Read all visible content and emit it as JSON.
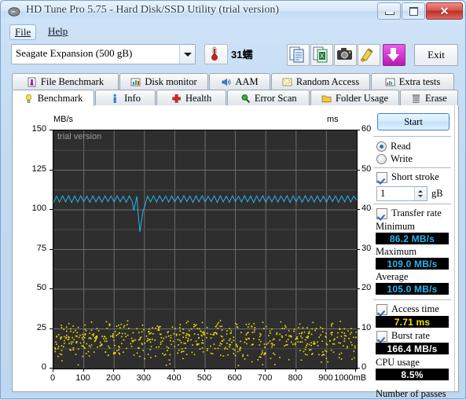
{
  "window": {
    "title": "HD Tune Pro 5.75 - Hard Disk/SSD Utility (trial version)",
    "icon": "hdtune-logo-icon",
    "controls": {
      "minimize": "minimize-icon",
      "maximize": "maximize-icon",
      "close": "close-icon"
    }
  },
  "menubar": {
    "items": [
      {
        "label": "File"
      },
      {
        "label": "Help"
      }
    ]
  },
  "toolbar": {
    "drive_select": {
      "value": "Seagate Expansion (500 gB)",
      "options": [
        "Seagate Expansion (500 gB)"
      ]
    },
    "temperature": {
      "icon": "thermometer-icon",
      "value": "31蠕"
    },
    "buttons": [
      {
        "name": "copy-to-clipboard-button",
        "icon": "copy-icon"
      },
      {
        "name": "export-excel-button",
        "icon": "excel-export-icon"
      },
      {
        "name": "screenshot-button",
        "icon": "camera-icon"
      },
      {
        "name": "clean-button",
        "icon": "brush-icon"
      },
      {
        "name": "download-button",
        "icon": "down-arrow-icon"
      }
    ],
    "exit_label": "Exit"
  },
  "tabs": {
    "top_row": [
      {
        "label": "File Benchmark",
        "icon": "file-benchmark-icon",
        "selected": false
      },
      {
        "label": "Disk monitor",
        "icon": "disk-monitor-icon",
        "selected": false
      },
      {
        "label": "AAM",
        "icon": "speaker-icon",
        "selected": false
      },
      {
        "label": "Random Access",
        "icon": "random-access-icon",
        "selected": false
      },
      {
        "label": "Extra tests",
        "icon": "extra-tests-icon",
        "selected": false
      }
    ],
    "bottom_row": [
      {
        "label": "Benchmark",
        "icon": "bulb-icon",
        "selected": true
      },
      {
        "label": "Info",
        "icon": "info-icon",
        "selected": false
      },
      {
        "label": "Health",
        "icon": "health-cross-icon",
        "selected": false
      },
      {
        "label": "Error Scan",
        "icon": "magnifier-icon",
        "selected": false
      },
      {
        "label": "Folder Usage",
        "icon": "folder-icon",
        "selected": false
      },
      {
        "label": "Erase",
        "icon": "trash-icon",
        "selected": false
      }
    ]
  },
  "controls": {
    "start_label": "Start",
    "mode": {
      "read_label": "Read",
      "write_label": "Write",
      "selected": "Read"
    },
    "short_stroke": {
      "label": "Short stroke",
      "checked": true,
      "value": "1",
      "unit": "gB"
    },
    "transfer_rate": {
      "label": "Transfer rate",
      "checked": true
    },
    "minimum": {
      "label": "Minimum",
      "value": "86.2 MB/s"
    },
    "maximum": {
      "label": "Maximum",
      "value": "109.0 MB/s"
    },
    "average": {
      "label": "Average",
      "value": "105.0 MB/s"
    },
    "access_time": {
      "label": "Access time",
      "checked": true,
      "value": "7.71 ms"
    },
    "burst_rate": {
      "label": "Burst rate",
      "checked": true,
      "value": "166.4 MB/s"
    },
    "cpu_usage": {
      "label": "CPU usage",
      "value": "8.5%"
    },
    "passes_label": "Number of passes"
  },
  "chart_data": {
    "type": "line",
    "title": "",
    "watermark": "trial version",
    "xlabel": "",
    "ylabel": "MB/s",
    "y2label": "ms",
    "xlim": [
      0,
      1000
    ],
    "ylim": [
      0,
      150
    ],
    "y2lim": [
      0,
      60
    ],
    "x_ticks": [
      "0",
      "100",
      "200",
      "300",
      "400",
      "500",
      "600",
      "700",
      "800",
      "900",
      "1000mB"
    ],
    "x_tick_values": [
      0,
      100,
      200,
      300,
      400,
      500,
      600,
      700,
      800,
      900,
      1000
    ],
    "y_ticks": [
      "0",
      "25",
      "50",
      "75",
      "100",
      "125",
      "150"
    ],
    "y_tick_values": [
      0,
      25,
      50,
      75,
      100,
      125,
      150
    ],
    "y2_ticks": [
      "0",
      "10",
      "20",
      "30",
      "40",
      "50",
      "60"
    ],
    "y2_tick_values": [
      0,
      10,
      20,
      30,
      40,
      50,
      60
    ],
    "grid": true,
    "plot_background": "#2e2e2e",
    "series": [
      {
        "name": "Transfer rate",
        "type": "line",
        "color": "#29b4ee",
        "axis": "left",
        "units": "MB/s",
        "x": [
          0,
          10,
          20,
          30,
          40,
          50,
          60,
          70,
          80,
          90,
          100,
          110,
          120,
          130,
          140,
          150,
          160,
          170,
          180,
          190,
          200,
          210,
          220,
          230,
          240,
          250,
          260,
          265,
          270,
          275,
          280,
          285,
          290,
          295,
          300,
          310,
          320,
          330,
          340,
          350,
          360,
          370,
          380,
          390,
          400,
          410,
          420,
          430,
          440,
          450,
          460,
          470,
          480,
          490,
          500,
          510,
          520,
          530,
          540,
          550,
          560,
          570,
          580,
          590,
          600,
          610,
          620,
          630,
          640,
          650,
          660,
          670,
          680,
          690,
          700,
          710,
          720,
          730,
          740,
          750,
          760,
          770,
          780,
          790,
          800,
          810,
          820,
          830,
          840,
          850,
          860,
          870,
          880,
          890,
          900,
          910,
          920,
          930,
          940,
          950,
          960,
          970,
          980,
          990,
          1000
        ],
        "y": [
          104.5,
          108.6,
          104.8,
          108.8,
          105.0,
          108.9,
          104.6,
          108.7,
          104.9,
          108.8,
          105.1,
          108.6,
          104.7,
          108.9,
          105.0,
          108.5,
          104.8,
          108.8,
          105.2,
          108.7,
          104.9,
          108.9,
          105.0,
          108.6,
          104.7,
          108.8,
          105.1,
          99.5,
          104.0,
          108.5,
          96.0,
          86.2,
          92.5,
          99.0,
          101.5,
          108.6,
          105.0,
          108.8,
          104.8,
          108.9,
          105.1,
          108.7,
          104.9,
          108.8,
          105.0,
          108.6,
          104.8,
          108.9,
          105.2,
          108.7,
          104.6,
          108.8,
          105.0,
          108.9,
          104.9,
          108.6,
          105.1,
          108.8,
          104.7,
          108.9,
          105.0,
          108.7,
          104.8,
          108.8,
          105.2,
          108.6,
          104.9,
          108.9,
          105.0,
          108.7,
          104.6,
          108.8,
          105.1,
          108.9,
          104.8,
          108.6,
          105.0,
          108.8,
          104.9,
          108.7,
          105.2,
          108.9,
          104.7,
          108.8,
          105.0,
          108.6,
          104.8,
          108.9,
          105.1,
          108.7,
          104.9,
          108.8,
          105.0,
          108.6,
          104.7,
          108.9,
          105.2,
          108.7,
          104.8,
          108.8,
          105.0,
          108.9,
          104.9,
          108.6,
          106.0
        ]
      },
      {
        "name": "Access time",
        "type": "scatter",
        "color": "#f2e000",
        "axis": "right",
        "units": "ms",
        "point_count": 640,
        "mean_ms": 7.71,
        "range_ms": [
          0.5,
          13.0
        ]
      }
    ]
  }
}
